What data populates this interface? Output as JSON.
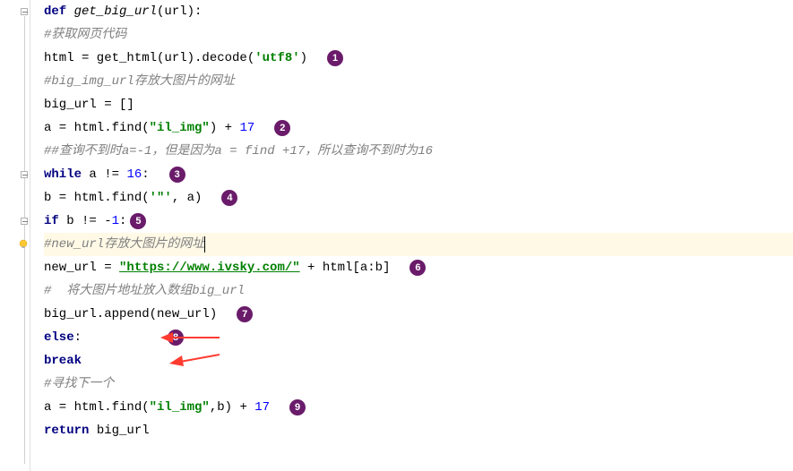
{
  "code": {
    "l1_def": "def ",
    "l1_fn": "get_big_url",
    "l1_rest": "(url):",
    "l2": "#获取网页代码",
    "l3a": "html = get_html(url).decode(",
    "l3s": "'utf8'",
    "l3b": ")",
    "l4": "#big_img_url存放大图片的网址",
    "l5a": "big_url = []",
    "l6a": "a = html.find(",
    "l6s": "\"il_img\"",
    "l6b": ") + ",
    "l6n": "17",
    "l7a": "##",
    "l7b": "查询不到时",
    "l7c": "a=-1，",
    "l7d": "但是因为",
    "l7e": "a = find +17，",
    "l7f": "所以查询不到时为",
    "l7g": "16",
    "l8_kw": "while ",
    "l8a": "a != ",
    "l8n": "16",
    "l8b": ":",
    "l9a": "b = html.find(",
    "l9s": "'\"'",
    "l9b": ", a)",
    "l10_kw": "if ",
    "l10a": "b != -",
    "l10n": "1",
    "l10b": ":",
    "l11": "#new_url存放大图片的网址",
    "l12a": "new_url = ",
    "l12s": "\"https://www.ivsky.com/\"",
    "l12b": " + html[a:b]",
    "l13": "#  将大图片地址放入数组big_url",
    "l14a": "big_url.append(new_url)",
    "l15_kw": "else",
    "l15a": ":",
    "l16_kw": "break",
    "l17": "#寻找下一个",
    "l18a": "a = html.find(",
    "l18s": "\"il_img\"",
    "l18b": ",b) + ",
    "l18n": "17",
    "l19_kw": "return ",
    "l19a": "big_url"
  },
  "badges": {
    "b1": "1",
    "b2": "2",
    "b3": "3",
    "b4": "4",
    "b5": "5",
    "b6": "6",
    "b7": "7",
    "b8": "8",
    "b9": "9"
  },
  "colors": {
    "badge_bg": "#6a1b6a",
    "arrow": "#ff3b30",
    "highlight": "#fff9e6"
  }
}
